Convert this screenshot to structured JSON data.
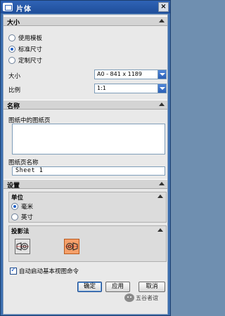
{
  "window": {
    "title": "片体",
    "close_glyph": "×"
  },
  "size_section": {
    "header": "大小",
    "options": [
      {
        "label": "使用模板",
        "selected": false
      },
      {
        "label": "标准尺寸",
        "selected": true
      },
      {
        "label": "定制尺寸",
        "selected": false
      }
    ],
    "size_label": "大小",
    "size_value": "A0 - 841 x 1189",
    "scale_label": "比例",
    "scale_value": "1:1"
  },
  "name_section": {
    "header": "名称",
    "pages_label": "图纸中的图纸页",
    "pages": [],
    "page_name_label": "图纸页名称",
    "page_name_value": "Sheet 1"
  },
  "settings_section": {
    "header": "设置",
    "units_group": {
      "header": "单位",
      "options": [
        {
          "label": "毫米",
          "selected": true
        },
        {
          "label": "英寸",
          "selected": false
        }
      ]
    },
    "projection_group": {
      "header": "投影法",
      "options": [
        {
          "name": "first-angle",
          "active": false
        },
        {
          "name": "third-angle",
          "active": true
        }
      ]
    },
    "auto_view_checkbox": {
      "label": "自动启动基本视图命令",
      "checked": true
    }
  },
  "buttons": {
    "ok": "确定",
    "apply": "应用",
    "cancel": "取消"
  },
  "watermark": {
    "text": "五谷者谊"
  },
  "colors": {
    "title_bar": "#1f4e9a",
    "panel": "#e9e9e9",
    "active_projection": "#f5a06a",
    "accent": "#1f5fc7"
  }
}
